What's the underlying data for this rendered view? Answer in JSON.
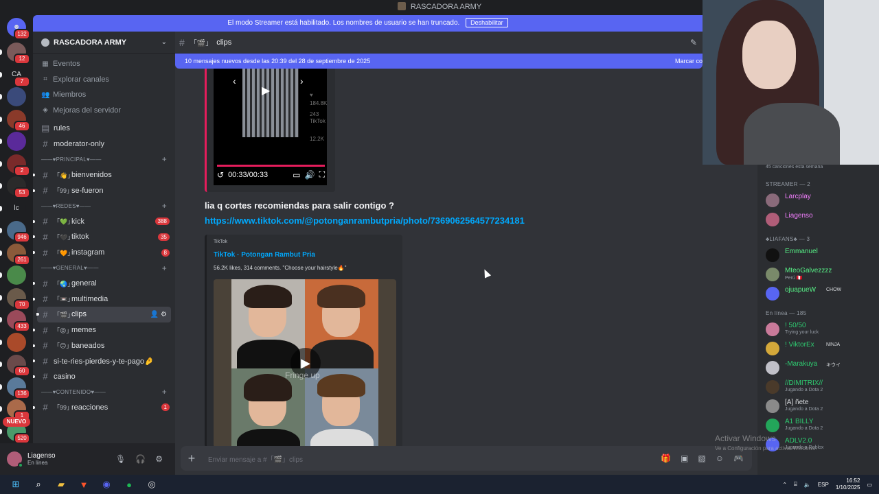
{
  "window": {
    "title": "RASCADORA ARMY"
  },
  "colors": {
    "accent": "#5865f2",
    "badge": "#da373c",
    "link": "#00a8fc",
    "online": "#23a55a"
  },
  "streamer_banner": {
    "text": "El modo Streamer está habilitado. Los nombres de usuario se han truncado.",
    "button": "Deshabilitar"
  },
  "rail": {
    "dm_badge": "132",
    "servers": [
      {
        "text": "",
        "badge": "12",
        "color": "#7a5a5a"
      },
      {
        "text": "CA",
        "badge": "7",
        "color": "#1e1f22"
      },
      {
        "text": "",
        "badge": "",
        "color": "#3a4a7a"
      },
      {
        "text": "",
        "badge": "46",
        "color": "#8a3a2a"
      },
      {
        "text": "",
        "badge": "",
        "color": "#5a2a9a"
      },
      {
        "text": "",
        "badge": "2",
        "color": "#7a2a2a"
      },
      {
        "text": "",
        "badge": "53",
        "color": "#2a2a2a"
      },
      {
        "text": "lc",
        "badge": "",
        "color": "#1e1f22"
      },
      {
        "text": "",
        "badge": "946",
        "color": "#4a6a8a"
      },
      {
        "text": "",
        "badge": "261",
        "color": "#8a5a3a"
      },
      {
        "text": "",
        "badge": "",
        "color": "#4a8a4a"
      },
      {
        "text": "",
        "badge": "70",
        "color": "#6a5a4a"
      },
      {
        "text": "",
        "badge": "433",
        "color": "#9a4a5a"
      },
      {
        "text": "",
        "badge": "",
        "color": "#aa4a2a"
      },
      {
        "text": "",
        "badge": "60",
        "color": "#6a4a4a"
      },
      {
        "text": "",
        "badge": "136",
        "color": "#5a7a9a"
      },
      {
        "text": "",
        "badge": "1",
        "color": "#aa6a4a"
      },
      {
        "text": "",
        "badge": "520",
        "color": "#4a9a6a"
      }
    ],
    "new_label": "NUEVO"
  },
  "sidebar": {
    "server_name": "RASCADORA ARMY",
    "nav": [
      {
        "icon": "calendar-icon",
        "glyph": "▦",
        "label": "Eventos"
      },
      {
        "icon": "explore-icon",
        "glyph": "⌗",
        "label": "Explorar canales"
      },
      {
        "icon": "members-icon",
        "glyph": "👥",
        "label": "Miembros"
      },
      {
        "icon": "boost-icon",
        "glyph": "◈",
        "label": "Mejoras del servidor"
      }
    ],
    "top_channels": [
      {
        "glyph": "▤",
        "emoji": "",
        "name": "rules",
        "count": ""
      },
      {
        "glyph": "#",
        "emoji": "",
        "name": "moderator-only",
        "count": ""
      }
    ],
    "categories": [
      {
        "label": "——♥PRINCIPAL♥——",
        "channels": [
          {
            "emoji": "「👋」",
            "name": "bienvenidos",
            "count": ""
          },
          {
            "emoji": "「99」",
            "name": "se-fueron",
            "count": ""
          }
        ]
      },
      {
        "label": "——♥REDES♥——",
        "channels": [
          {
            "emoji": "「💚」",
            "name": "kick",
            "count": "388"
          },
          {
            "emoji": "「🖤」",
            "name": "tiktok",
            "count": "35"
          },
          {
            "emoji": "「🧡」",
            "name": "instagram",
            "count": "8"
          }
        ]
      },
      {
        "label": "——♥GENERAL♥——",
        "channels": [
          {
            "emoji": "「🌏」",
            "name": "general",
            "count": ""
          },
          {
            "emoji": "「📼」",
            "name": "multimedia",
            "count": ""
          },
          {
            "emoji": "「🎬」",
            "name": "clips",
            "count": "",
            "active": true
          },
          {
            "emoji": "「😝」",
            "name": "memes",
            "count": ""
          },
          {
            "emoji": "「😑」",
            "name": "baneados",
            "count": ""
          },
          {
            "emoji": "",
            "name": "si-te-ries-pierdes-y-te-pago🤌",
            "count": ""
          },
          {
            "emoji": "",
            "name": "casino",
            "count": ""
          }
        ]
      },
      {
        "label": "——♥CONTENIDO♥——",
        "channels": [
          {
            "emoji": "「99」",
            "name": "reacciones",
            "count": "1"
          }
        ]
      }
    ]
  },
  "user_panel": {
    "name": "Liagenso",
    "status": "En línea"
  },
  "channel": {
    "prefix": "「🎬」",
    "name": "clips"
  },
  "new_messages_bar": {
    "text": "10 mensajes nuevos desde las 20:39 del 28 de septiembre de 2025",
    "action": "Marcar co"
  },
  "video": {
    "time": "00:33/00:33",
    "likes": "184.8K",
    "comments": "243",
    "shares": "12.2K",
    "brand": "TikTok"
  },
  "message": {
    "text": "lia q cortes recomiendas para salir contigo ?",
    "link": "https://www.tiktok.com/@potonganrambutpria/photo/7369062564577234181"
  },
  "embed": {
    "provider": "TikTok",
    "title": "TikTok · Potongan Rambut Pria",
    "description": "56.2K likes, 314 comments. \"Choose your hairstyle🔥\"",
    "caption": "Fringe up"
  },
  "composer": {
    "placeholder": "Enviar mensaje a #「🎬」clips"
  },
  "members": {
    "activity": "45 canciones esta semana",
    "groups": [
      {
        "header": "STREAMER — 2",
        "items": [
          {
            "name": "Larcplay",
            "sub": "",
            "tag": "",
            "color": "#f47fff",
            "avatar": "#8a6a7a"
          },
          {
            "name": "Liagenso",
            "sub": "",
            "tag": "",
            "color": "#f47fff",
            "avatar": "#b05d78"
          }
        ]
      },
      {
        "header": "♣LIAFANS♣ — 3",
        "items": [
          {
            "name": "Emmanuel",
            "sub": "",
            "tag": "",
            "color": "#57f287",
            "avatar": "#111111"
          },
          {
            "name": "MteoGalvezzzz",
            "sub": "Perú 🇵🇪",
            "tag": "",
            "color": "#57f287",
            "avatar": "#7a8a6a"
          },
          {
            "name": "ojuapueW",
            "sub": "",
            "tag": "CHOW",
            "color": "#57f287",
            "avatar": "#5865f2"
          }
        ]
      },
      {
        "header": "En línea — 185",
        "items": [
          {
            "name": "! 50/50",
            "sub": "Trying your luck",
            "tag": "",
            "color": "#2ecc71",
            "avatar": "#c97a9a"
          },
          {
            "name": "! ViktorEx",
            "sub": "",
            "tag": "NINJA",
            "color": "#2ecc71",
            "avatar": "#d4a83a"
          },
          {
            "name": "-Marakuya",
            "sub": "",
            "tag": "キウイ",
            "color": "#2ecc71",
            "avatar": "#c0c0c8"
          },
          {
            "name": "//DIMITRIX//",
            "sub": "Jugando a Dota 2",
            "tag": "",
            "color": "#2ecc71",
            "avatar": "#4a3a2a"
          },
          {
            "name": "[A] ñete",
            "sub": "Jugando a Dota 2",
            "tag": "",
            "color": "#dbdee1",
            "avatar": "#8a8a8a"
          },
          {
            "name": "A1 BILLY",
            "sub": "Jugando a Dota 2",
            "tag": "",
            "color": "#2ecc71",
            "avatar": "#23a55a"
          },
          {
            "name": "ADLV2.0",
            "sub": "Jugando a Roblox",
            "tag": "",
            "color": "#2ecc71",
            "avatar": "#5865f2"
          }
        ]
      }
    ]
  },
  "watermark": {
    "title": "Activar Windows",
    "subtitle": "Ve a Configuración para activar Windows."
  },
  "taskbar": {
    "apps": [
      {
        "name": "windows-start-icon",
        "glyph": "⊞",
        "color": "#4cc2ff"
      },
      {
        "name": "search-icon",
        "glyph": "⌕",
        "color": "#ffffff"
      },
      {
        "name": "file-explorer-icon",
        "glyph": "▰",
        "color": "#f0c040"
      },
      {
        "name": "brave-browser-icon",
        "glyph": "▼",
        "color": "#fb542b"
      },
      {
        "name": "discord-icon",
        "glyph": "◉",
        "color": "#5865f2"
      },
      {
        "name": "spotify-icon",
        "glyph": "●",
        "color": "#1db954"
      },
      {
        "name": "obs-icon",
        "glyph": "◎",
        "color": "#dddddd"
      }
    ],
    "lang": "ESP",
    "time": "16:52",
    "date": "1/10/2025"
  }
}
